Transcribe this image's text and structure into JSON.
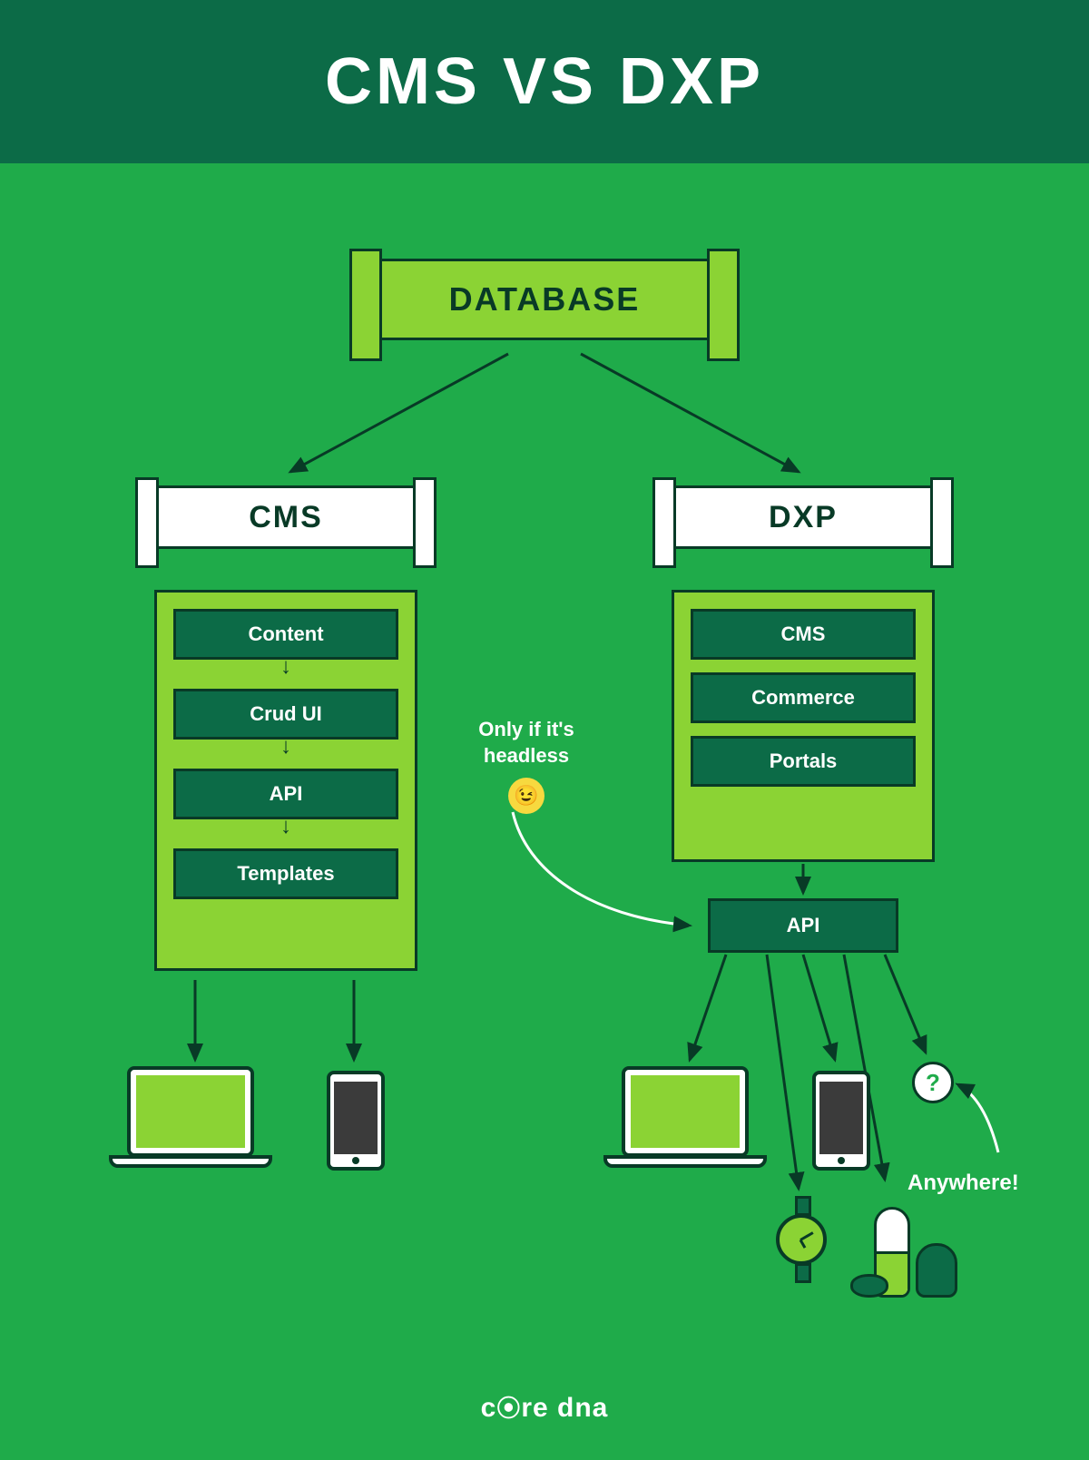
{
  "title": "CMS VS DXP",
  "database_label": "DATABASE",
  "cms": {
    "heading": "CMS",
    "items": [
      "Content",
      "Crud UI",
      "API",
      "Templates"
    ],
    "outputs": [
      "laptop",
      "phone"
    ]
  },
  "dxp": {
    "heading": "DXP",
    "items": [
      "CMS",
      "Commerce",
      "Portals"
    ],
    "api_label": "API",
    "outputs": [
      "laptop",
      "phone",
      "watch",
      "smart-speakers",
      "anywhere"
    ]
  },
  "notes": {
    "headless": "Only if it's headless",
    "anywhere": "Anywhere!"
  },
  "question_mark": "?",
  "brand": "core dna"
}
